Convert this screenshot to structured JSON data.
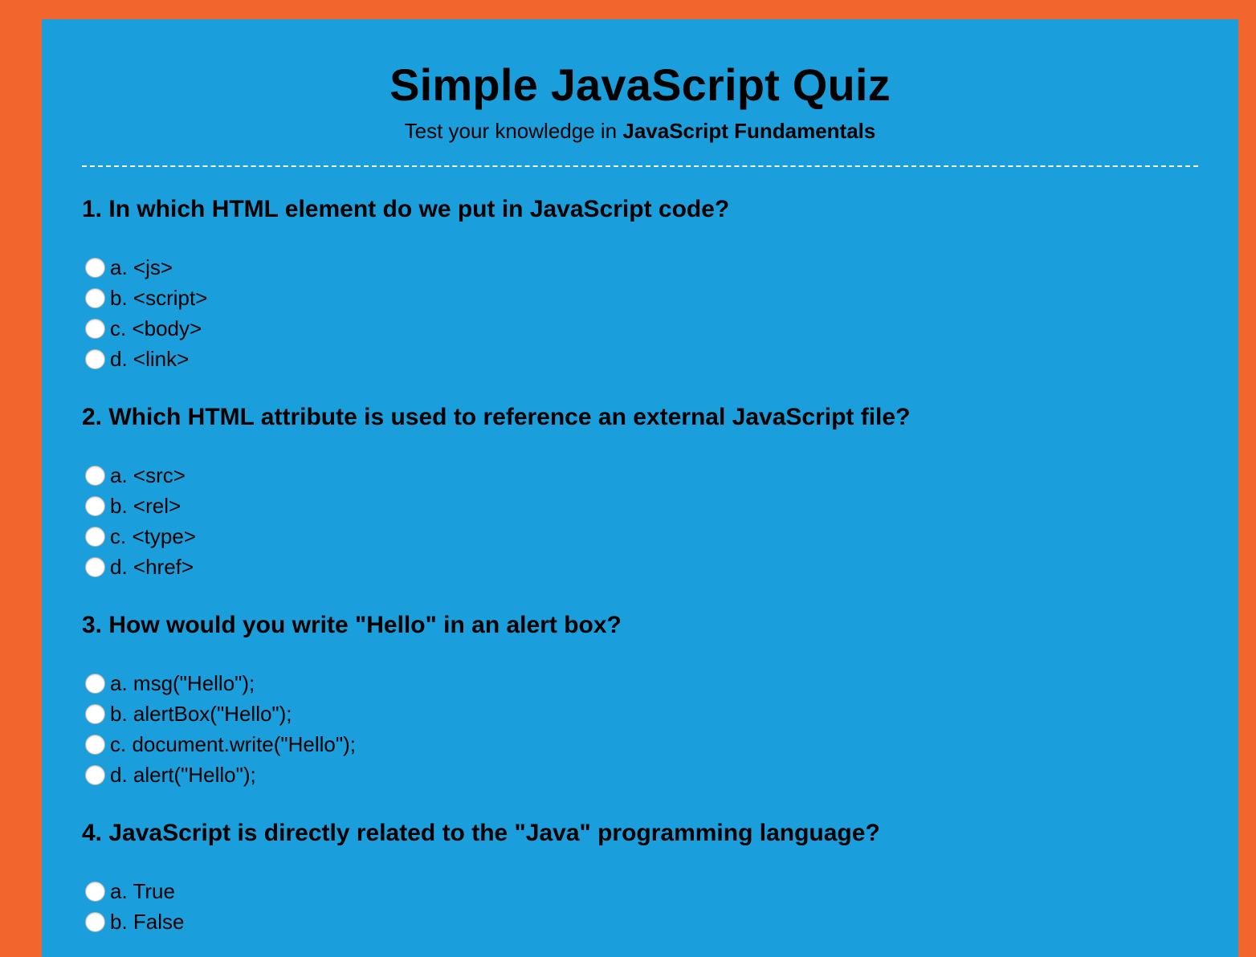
{
  "header": {
    "title": "Simple JavaScript Quiz",
    "subtitle_prefix": "Test your knowledge in ",
    "subtitle_strong": "JavaScript Fundamentals"
  },
  "colors": {
    "page_bg": "#F2652D",
    "panel_bg": "#1A9FDC",
    "divider": "#FFFFFF"
  },
  "questions": [
    {
      "text": "1. In which HTML element do we put in JavaScript code?",
      "options": [
        "a. <js>",
        "b. <script>",
        "c. <body>",
        "d. <link>"
      ]
    },
    {
      "text": "2. Which HTML attribute is used to reference an external JavaScript file?",
      "options": [
        "a. <src>",
        "b. <rel>",
        "c. <type>",
        "d. <href>"
      ]
    },
    {
      "text": "3. How would you write \"Hello\" in an alert box?",
      "options": [
        "a. msg(\"Hello\");",
        "b. alertBox(\"Hello\");",
        "c. document.write(\"Hello\");",
        "d. alert(\"Hello\");"
      ]
    },
    {
      "text": "4. JavaScript is directly related to the \"Java\" programming language?",
      "options": [
        "a. True",
        "b. False"
      ]
    }
  ]
}
